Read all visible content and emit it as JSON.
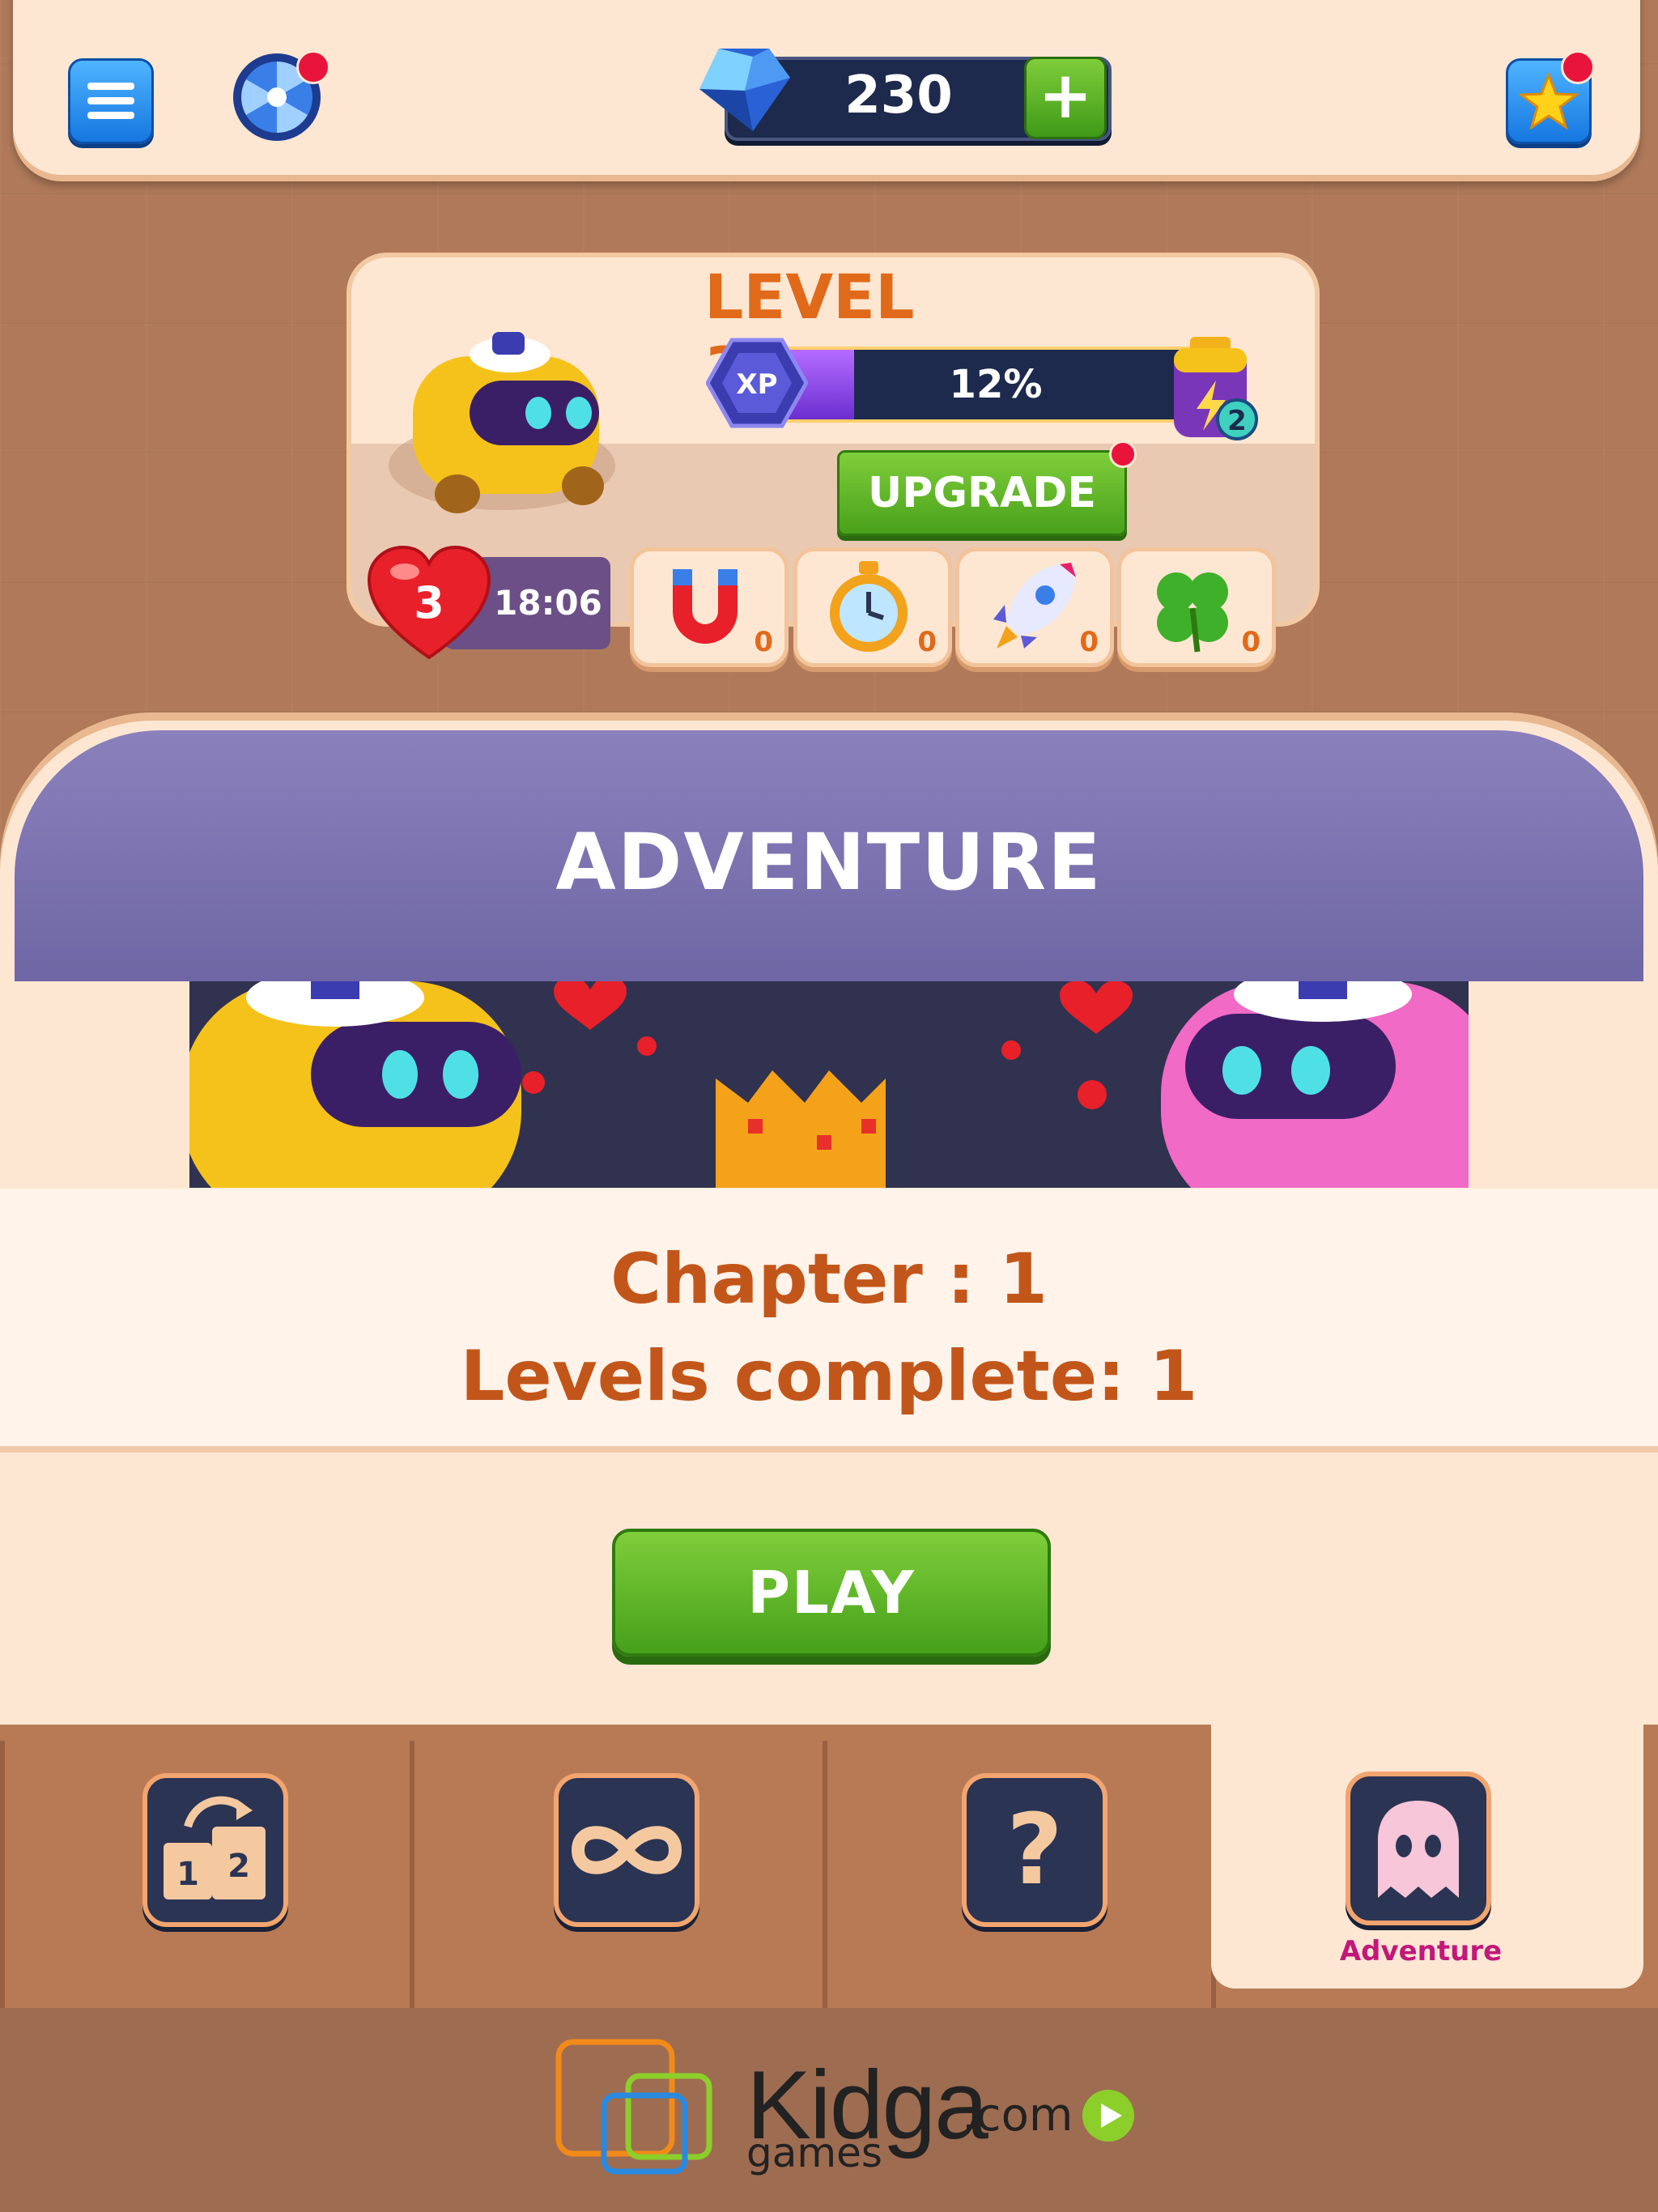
{
  "topbar": {
    "menu_icon": "hamburger-menu-icon",
    "wheel_icon": "lucky-wheel-icon",
    "gems": "230",
    "gem_icon": "blue-gem-icon",
    "add_label": "+",
    "favorite_icon": "star-icon"
  },
  "level_panel": {
    "title": "LEVEL 3",
    "xp_badge": "XP",
    "xp_progress": 0.12,
    "xp_text": "12%",
    "battery_count": "2",
    "upgrade_label": "UPGRADE",
    "lives": "3",
    "lives_timer": "18:06",
    "boosters": [
      {
        "icon": "magnet-icon",
        "count": "0"
      },
      {
        "icon": "stopwatch-icon",
        "count": "0"
      },
      {
        "icon": "rocket-icon",
        "count": "0"
      },
      {
        "icon": "clover-icon",
        "count": "0"
      }
    ]
  },
  "mode": {
    "title": "ADVENTURE",
    "chapter": "Chapter : 1",
    "levels_complete": "Levels complete: 1",
    "play_label": "PLAY"
  },
  "bottom_nav": {
    "tabs": [
      {
        "icon": "podium-icon",
        "label": ""
      },
      {
        "icon": "infinity-icon",
        "label": ""
      },
      {
        "icon": "question-icon",
        "label": ""
      },
      {
        "icon": "ghost-icon",
        "label": "Adventure"
      }
    ],
    "active_index": 3
  },
  "footer": {
    "brand": "Kidga",
    "domain": ".com",
    "sub": "games"
  },
  "colors": {
    "accent_orange": "#e06a1a",
    "header_purple": "#7a71b0",
    "play_green": "#5bb02a",
    "active_label": "#c2187a"
  }
}
